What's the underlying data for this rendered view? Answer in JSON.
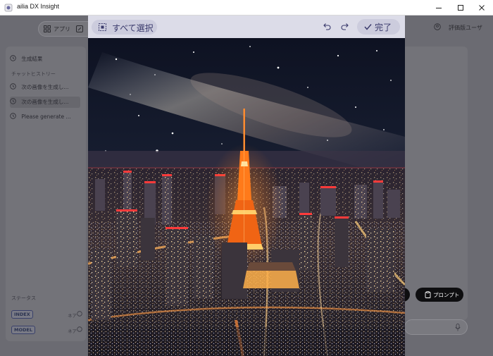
{
  "window": {
    "title": "ailia DX Insight",
    "controls": [
      "minimize-icon",
      "maximize-icon",
      "close-icon"
    ]
  },
  "toolbar": {
    "apps_label": "アプリ",
    "user_label": "評価版ユーザ"
  },
  "sidebar": {
    "generation_results": "生成結果",
    "history_title": "チャットヒストリー",
    "history_items": [
      {
        "label": "次の画像を生成し..."
      },
      {
        "label": "次の画像を生成し..."
      },
      {
        "label": "Please generate ..."
      }
    ],
    "status_title": "ステータス",
    "status_items": [
      {
        "badge": "INDEX",
        "value": "ネア"
      },
      {
        "badge": "MODEL",
        "value": "ネア"
      }
    ]
  },
  "main": {
    "prompt_button": "プロンプト"
  },
  "editor": {
    "select_all": "すべて選択",
    "done": "完了",
    "image_alt": "night city skyline with lit tower under the milky way"
  },
  "colors": {
    "accent": "#39396b",
    "editor_toolbar": "#dcdce8",
    "pill": "#ccccdd",
    "tower": "#ff7a1a"
  }
}
